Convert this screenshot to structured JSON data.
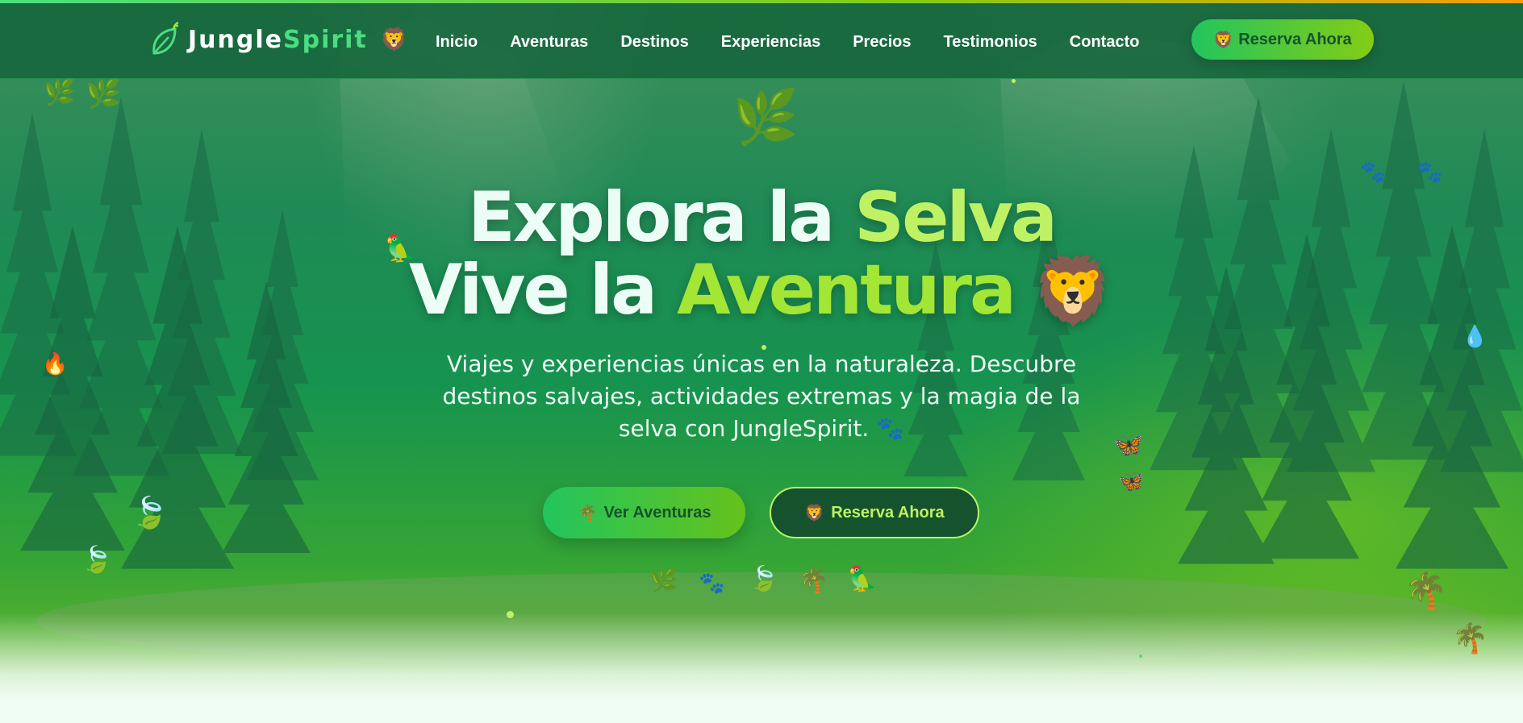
{
  "navbar": {
    "brand": {
      "name_part1": "Jungle",
      "name_part2": "Spirit",
      "emoji": "🦁",
      "logo_icon": "leaf-icon"
    },
    "links": [
      {
        "label": "Inicio"
      },
      {
        "label": "Aventuras"
      },
      {
        "label": "Destinos"
      },
      {
        "label": "Experiencias"
      },
      {
        "label": "Precios"
      },
      {
        "label": "Testimonios"
      },
      {
        "label": "Contacto"
      }
    ],
    "cta": {
      "emoji": "🦁",
      "label": "Reserva Ahora"
    }
  },
  "hero": {
    "headline": {
      "line1_prefix": "Explora la ",
      "line1_highlight": "Selva",
      "line2_prefix": "Vive la ",
      "line2_highlight": "Aventura",
      "line2_emoji": "🦁"
    },
    "subtitle": "Viajes y experiencias únicas en la naturaleza. Descubre destinos salvajes, actividades extremas y la magia de la selva con JungleSpirit.",
    "subtitle_emoji": "🐾",
    "primary_button": {
      "emoji": "🌴",
      "label": "Ver Aventuras"
    },
    "secondary_button": {
      "emoji": "🦁",
      "label": "Reserva Ahora"
    },
    "decorations": {
      "herb": "🌿",
      "paws": "🐾",
      "leaf_wind": "🍃",
      "palm": "🌴",
      "parrot": "🦜",
      "butterfly": "🦋",
      "fire": "🔥",
      "droplet": "💧"
    }
  },
  "colors": {
    "brand_green": "#4ade80",
    "lime_accent": "#a3e635",
    "dark_green": "#14532d",
    "nav_bg": "#16653c",
    "hero_text": "#ecfdf5"
  }
}
